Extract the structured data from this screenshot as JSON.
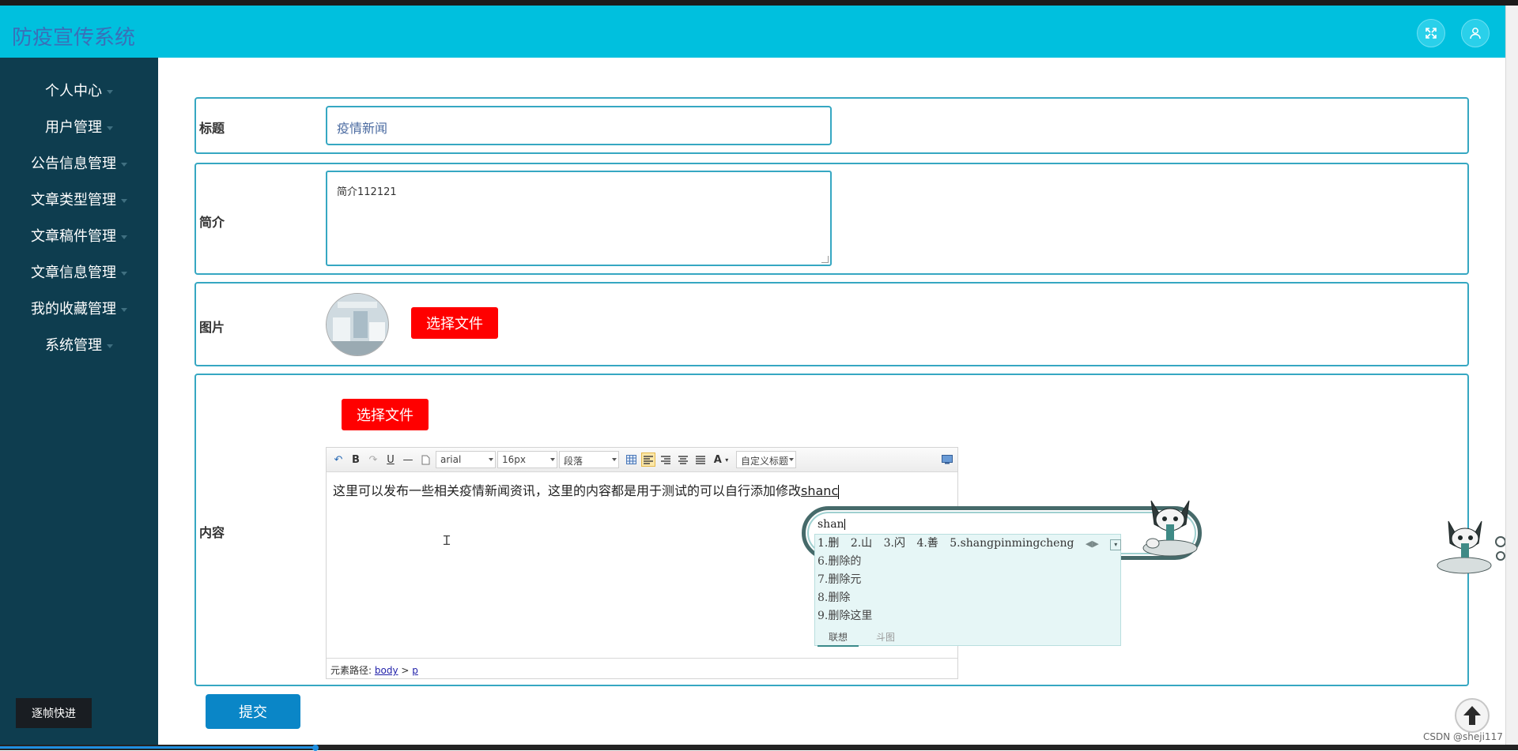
{
  "app": {
    "title": "防疫宣传系统"
  },
  "sidebar": {
    "items": [
      {
        "label": "个人中心"
      },
      {
        "label": "用户管理"
      },
      {
        "label": "公告信息管理"
      },
      {
        "label": "文章类型管理"
      },
      {
        "label": "文章稿件管理"
      },
      {
        "label": "文章信息管理"
      },
      {
        "label": "我的收藏管理"
      },
      {
        "label": "系统管理"
      }
    ],
    "quick_button": "逐帧快进"
  },
  "form": {
    "title": {
      "label": "标题",
      "value": "疫情新闻"
    },
    "summary": {
      "label": "简介",
      "value": "简介112121"
    },
    "image": {
      "label": "图片",
      "button": "选择文件"
    },
    "content": {
      "label": "内容",
      "button": "选择文件",
      "toolbar": {
        "font_family": "arial",
        "font_size": "16px",
        "paragraph": "段落",
        "font_color_icon": "A",
        "custom_title": "自定义标题"
      },
      "text": "这里可以发布一些相关疫情新闻资讯，这里的内容都是用于测试的可以自行添加修改",
      "typed": "shanc",
      "status": {
        "prefix": "元素路径:",
        "path_body": "body",
        "separator": " > ",
        "path_p": "p"
      }
    },
    "submit": "提交"
  },
  "ime": {
    "input": "shan",
    "candidates_first": [
      "1.删",
      "2.山",
      "3.闪",
      "4.善",
      "5.shangpinmingcheng"
    ],
    "candidates_more": [
      "6.删除的",
      "7.删除元",
      "8.删除",
      "9.删除这里"
    ],
    "tabs": [
      "联想",
      "斗图"
    ]
  },
  "watermark": "CSDN @sheji117",
  "colors": {
    "header": "#00c0de",
    "sidebar": "#0e3d4f",
    "border": "#36a7c2",
    "red_button": "#ff0000",
    "submit": "#0a86c7"
  }
}
